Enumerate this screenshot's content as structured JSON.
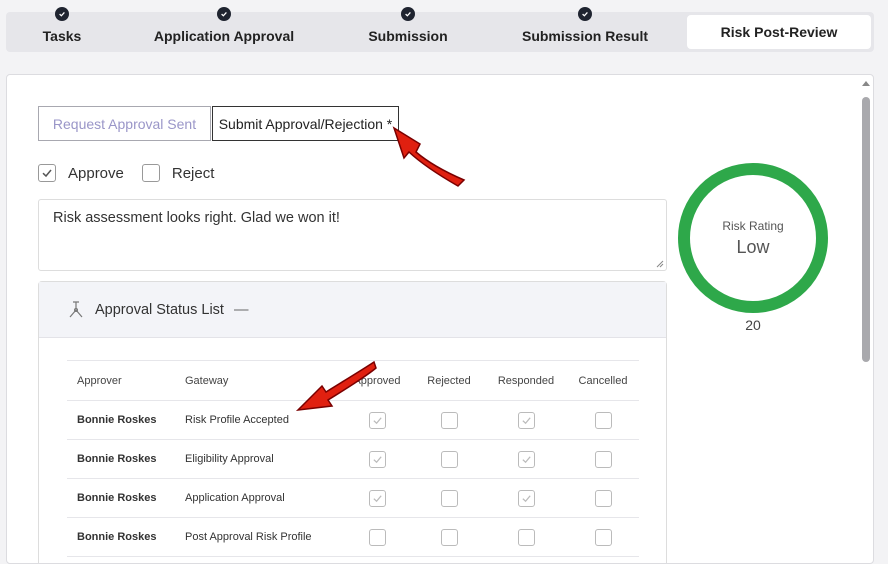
{
  "tabs": [
    {
      "label": "Tasks",
      "done": true
    },
    {
      "label": "Application Approval",
      "done": true
    },
    {
      "label": "Submission",
      "done": true
    },
    {
      "label": "Submission Result",
      "done": true
    },
    {
      "label": "Risk Post-Review",
      "done": false,
      "active": true
    }
  ],
  "actions": {
    "request_sent_label": "Request Approval Sent",
    "submit_label": "Submit Approval/Rejection *"
  },
  "decision": {
    "approve_label": "Approve",
    "approve_checked": true,
    "reject_label": "Reject",
    "reject_checked": false
  },
  "comment": "Risk assessment looks right. Glad we won it!",
  "risk": {
    "title": "Risk Rating",
    "value": "Low",
    "score": "20",
    "ring_color": "#2ea84a"
  },
  "approval_status": {
    "title": "Approval Status List",
    "columns": [
      "Approver",
      "Gateway",
      "Approved",
      "Rejected",
      "Responded",
      "Cancelled"
    ],
    "rows": [
      {
        "approver": "Bonnie Roskes",
        "gateway": "Risk Profile Accepted",
        "approved": true,
        "rejected": false,
        "responded": true,
        "cancelled": false
      },
      {
        "approver": "Bonnie Roskes",
        "gateway": "Eligibility Approval",
        "approved": true,
        "rejected": false,
        "responded": true,
        "cancelled": false
      },
      {
        "approver": "Bonnie Roskes",
        "gateway": "Application Approval",
        "approved": true,
        "rejected": false,
        "responded": true,
        "cancelled": false
      },
      {
        "approver": "Bonnie Roskes",
        "gateway": "Post Approval Risk Profile",
        "approved": false,
        "rejected": false,
        "responded": false,
        "cancelled": false
      }
    ]
  },
  "icons": {
    "tab_done": "check-circle-icon",
    "card": "tree-icon",
    "annotation": "red-arrow-icon"
  }
}
